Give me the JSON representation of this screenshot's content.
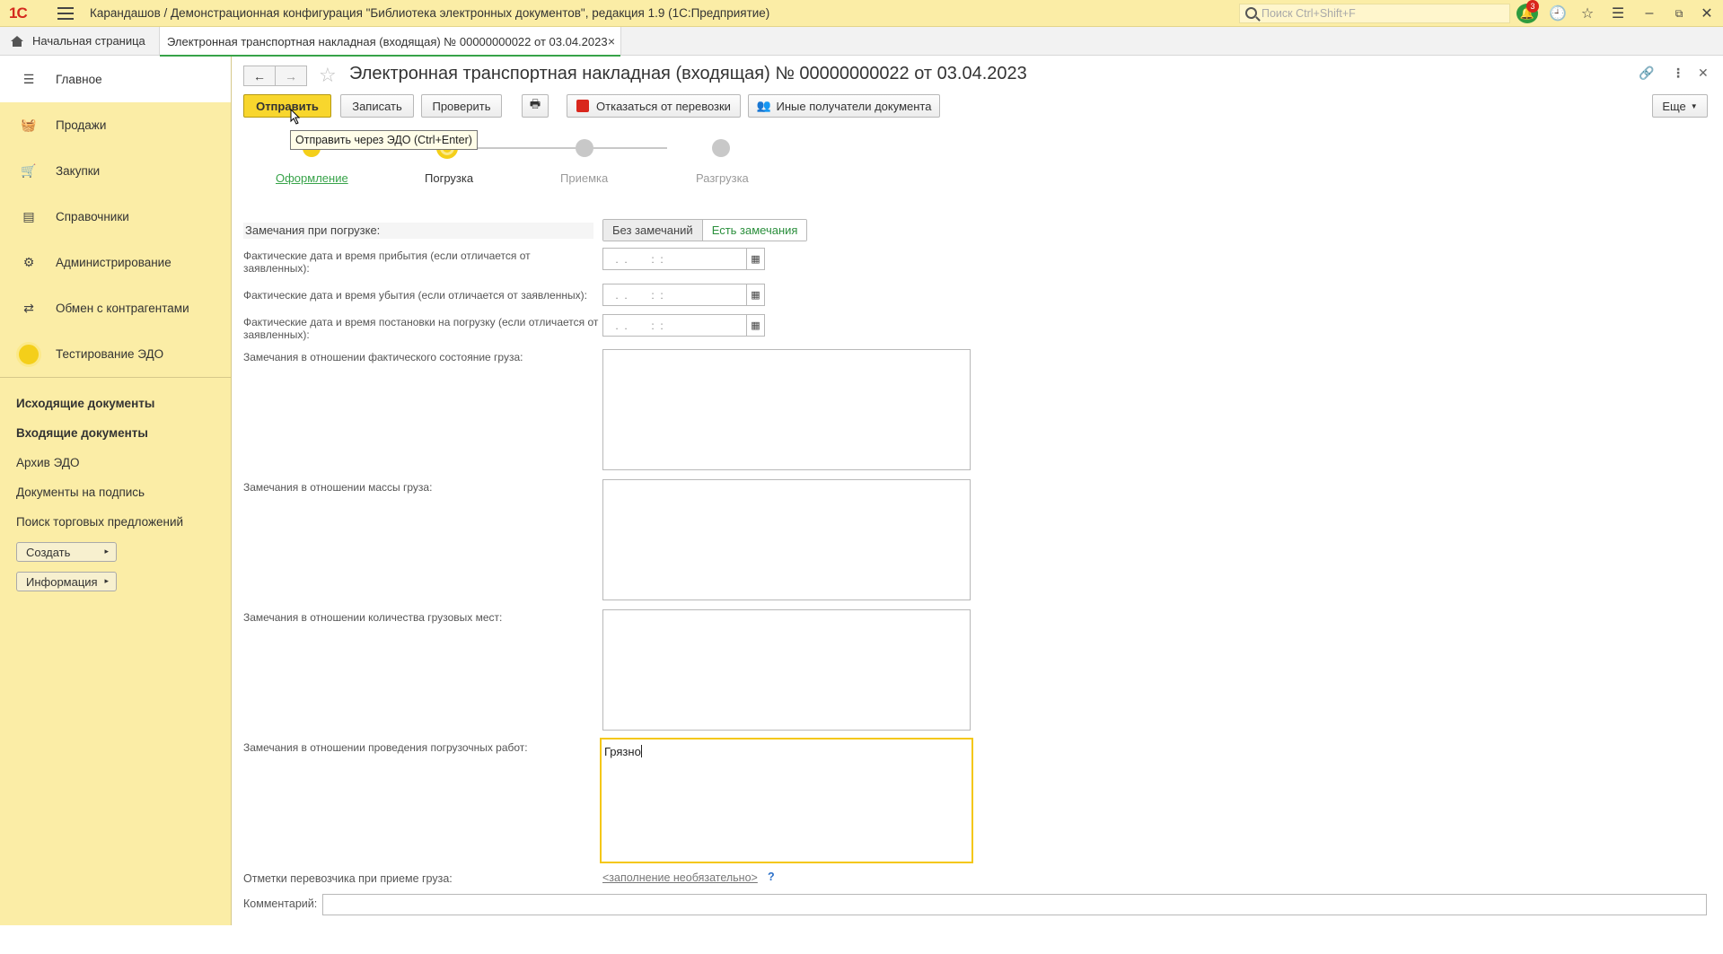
{
  "titlebar": {
    "logo": "1С",
    "title": "Карандашов / Демонстрационная конфигурация \"Библиотека электронных документов\", редакция 1.9  (1С:Предприятие)",
    "search_placeholder": "Поиск Ctrl+Shift+F",
    "notification_count": "3"
  },
  "tabs": {
    "home": "Начальная страница",
    "document": "Электронная транспортная накладная (входящая) № 00000000022 от 03.04.2023"
  },
  "sidebar": {
    "sections": [
      {
        "label": "Главное",
        "icon": "menu-icon"
      },
      {
        "label": "Продажи",
        "icon": "basket-icon"
      },
      {
        "label": "Закупки",
        "icon": "cart-icon"
      },
      {
        "label": "Справочники",
        "icon": "book-icon"
      },
      {
        "label": "Администрирование",
        "icon": "gear-icon"
      },
      {
        "label": "Обмен с контрагентами",
        "icon": "exchange-icon"
      },
      {
        "label": "Тестирование ЭДО",
        "icon": "circle-icon"
      }
    ],
    "links": [
      "Исходящие документы",
      "Входящие документы",
      "Архив ЭДО",
      "Документы на подпись",
      "Поиск торговых предложений"
    ],
    "create_button": "Создать",
    "info_button": "Информация"
  },
  "document": {
    "title": "Электронная транспортная накладная (входящая) № 00000000022 от 03.04.2023",
    "toolbar": {
      "send": "Отправить",
      "save": "Записать",
      "check": "Проверить",
      "refuse": "Отказаться от перевозки",
      "other_recipients": "Иные получатели документа",
      "more": "Еще"
    },
    "tooltip": "Отправить через ЭДО (Ctrl+Enter)",
    "steps": [
      {
        "label": "Оформление",
        "state": "done"
      },
      {
        "label": "Погрузка",
        "state": "current"
      },
      {
        "label": "Приемка",
        "state": "pending"
      },
      {
        "label": "Разгрузка",
        "state": "pending"
      }
    ],
    "form": {
      "remarks_label": "Замечания при погрузке:",
      "remarks_options": [
        "Без замечаний",
        "Есть замечания"
      ],
      "remarks_selected": "Есть замечания",
      "arrival_label": "Фактические дата и время прибытия (если отличается от заявленных):",
      "departure_label": "Фактические дата и время убытия (если отличается от заявленных):",
      "loading_label": "Фактические дата и время постановки на погрузку (если отличается от заявленных):",
      "date_mask": " .  .        :  :",
      "cargo_state_label": "Замечания в отношении фактического состояние груза:",
      "cargo_mass_label": "Замечания в отношении массы груза:",
      "cargo_places_label": "Замечания в отношении количества грузовых мест:",
      "loading_works_label": "Замечания в отношении проведения погрузочных работ:",
      "cargo_state_value": "",
      "cargo_mass_value": "",
      "cargo_places_value": "",
      "loading_works_value": "Грязно",
      "carrier_marks_label": "Отметки перевозчика при приеме груза:",
      "carrier_marks_link": "<заполнение необязательно>",
      "help": "?",
      "comment_label": "Комментарий:",
      "comment_value": ""
    }
  },
  "colors": {
    "panel": "#fbeda6",
    "primary_button": "#f8d62d",
    "accent_green": "#37a349",
    "focus_border": "#f4c712"
  }
}
